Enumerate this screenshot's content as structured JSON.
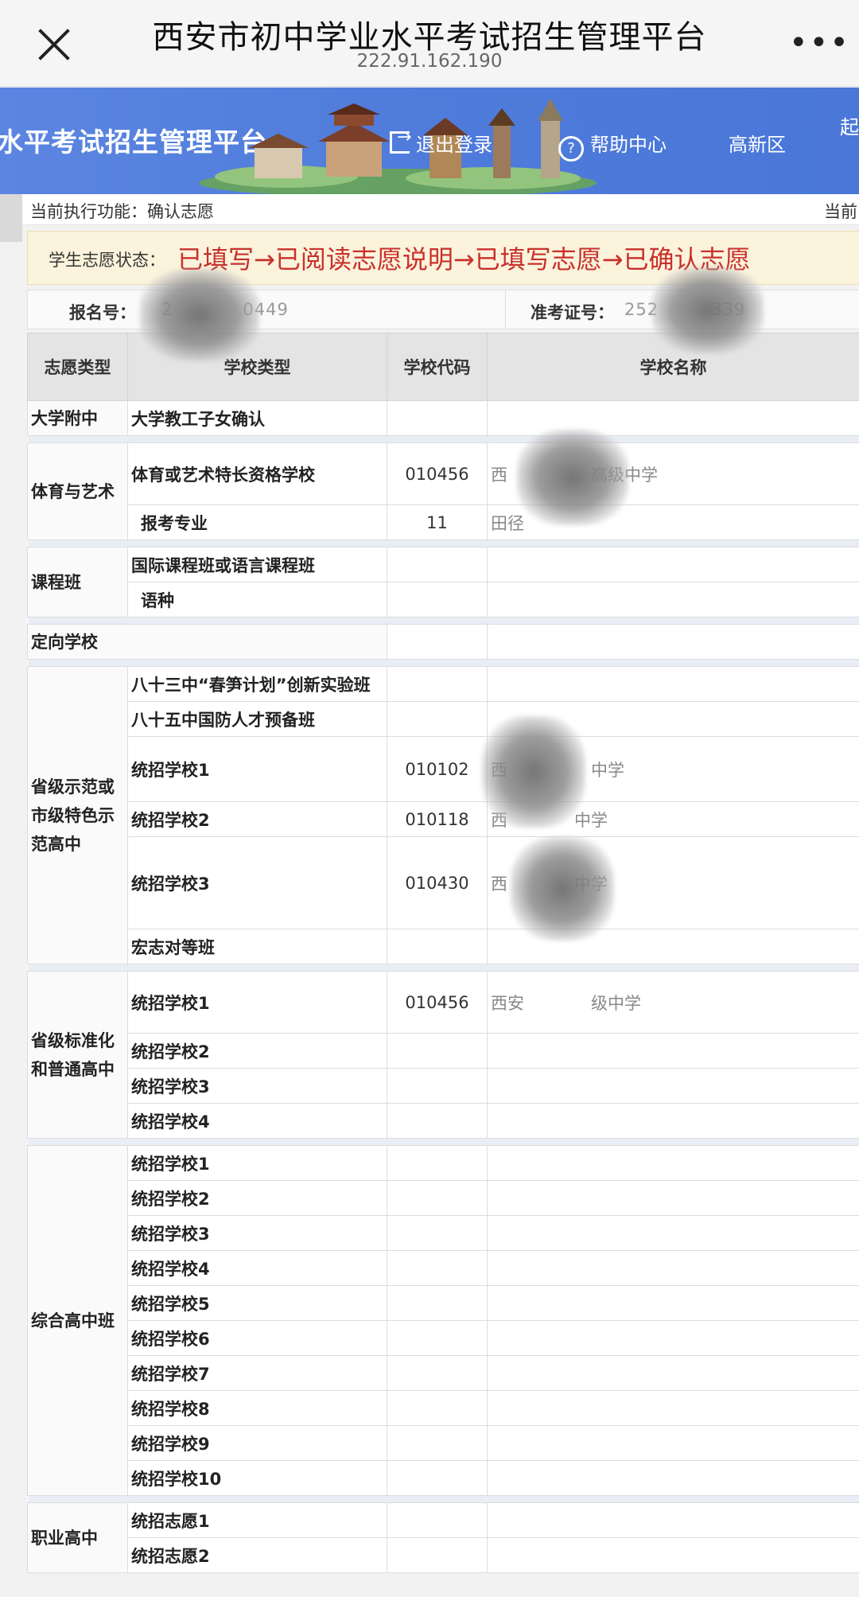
{
  "browser": {
    "title": "西安市初中学业水平考试招生管理平台",
    "url": "222.91.162.190"
  },
  "banner": {
    "site_title": "水平考试招生管理平台",
    "logout": "退出登录",
    "help": "帮助中心",
    "district": "高新区",
    "edge": "起"
  },
  "func_bar": {
    "label": "当前执行功能：确认志愿",
    "edge": "当前"
  },
  "status": {
    "label": "学生志愿状态：",
    "flow": "已填写→已阅读志愿说明→已填写志愿→已确认志愿"
  },
  "ids": {
    "reg_label": "报名号：",
    "reg_value": "2    0449",
    "ticket_label": "准考证号：",
    "ticket_value": "252   339"
  },
  "table": {
    "headers": [
      "志愿类型",
      "学校类型",
      "学校代码",
      "学校名称"
    ],
    "groups": {
      "g1": "大学附中",
      "g2": "体育与艺术",
      "g3": "课程班",
      "g4": "定向学校",
      "g5": "省级示范或市级特色示范高中",
      "g6": "省级标准化和普通高中",
      "g7": "综合高中班",
      "g8": "职业高中"
    },
    "rows": {
      "r1": {
        "type": "大学教工子女确认",
        "code": "",
        "name": ""
      },
      "r2": {
        "type": "体育或艺术特长资格学校",
        "code": "010456",
        "name": "西     高级中学"
      },
      "r3": {
        "type": "报考专业",
        "code": "11",
        "name": "田径"
      },
      "r4": {
        "type": "国际课程班或语言课程班",
        "code": "",
        "name": ""
      },
      "r5": {
        "type": "语种",
        "code": "",
        "name": ""
      },
      "r6": {
        "type": "八十三中“春笋计划”创新实验班",
        "code": "",
        "name": ""
      },
      "r7": {
        "type": "八十五中国防人才预备班",
        "code": "",
        "name": ""
      },
      "r8": {
        "type": "统招学校1",
        "code": "010102",
        "name": "西     中学"
      },
      "r9": {
        "type": "统招学校2",
        "code": "010118",
        "name": "西    中学"
      },
      "r10": {
        "type": "统招学校3",
        "code": "010430",
        "name": "西    中学"
      },
      "r11": {
        "type": "宏志对等班",
        "code": "",
        "name": ""
      },
      "r12": {
        "type": "统招学校1",
        "code": "010456",
        "name": "西安    级中学"
      },
      "r13": {
        "type": "统招学校2",
        "code": "",
        "name": ""
      },
      "r14": {
        "type": "统招学校3",
        "code": "",
        "name": ""
      },
      "r15": {
        "type": "统招学校4",
        "code": "",
        "name": ""
      },
      "r16": {
        "type": "统招学校1",
        "code": "",
        "name": ""
      },
      "r17": {
        "type": "统招学校2",
        "code": "",
        "name": ""
      },
      "r18": {
        "type": "统招学校3",
        "code": "",
        "name": ""
      },
      "r19": {
        "type": "统招学校4",
        "code": "",
        "name": ""
      },
      "r20": {
        "type": "统招学校5",
        "code": "",
        "name": ""
      },
      "r21": {
        "type": "统招学校6",
        "code": "",
        "name": ""
      },
      "r22": {
        "type": "统招学校7",
        "code": "",
        "name": ""
      },
      "r23": {
        "type": "统招学校8",
        "code": "",
        "name": ""
      },
      "r24": {
        "type": "统招学校9",
        "code": "",
        "name": ""
      },
      "r25": {
        "type": "统招学校10",
        "code": "",
        "name": ""
      },
      "r26": {
        "type": "统招志愿1",
        "code": "",
        "name": ""
      },
      "r27": {
        "type": "统招志愿2",
        "code": "",
        "name": ""
      }
    }
  },
  "colors": {
    "banner_blue": "#4f7bdb",
    "status_red": "#c9302c",
    "status_bg": "#fbf3dc",
    "header_gray": "#e4e4e4"
  },
  "icons": [
    "close-icon",
    "more-icon",
    "logout-icon",
    "help-icon"
  ]
}
